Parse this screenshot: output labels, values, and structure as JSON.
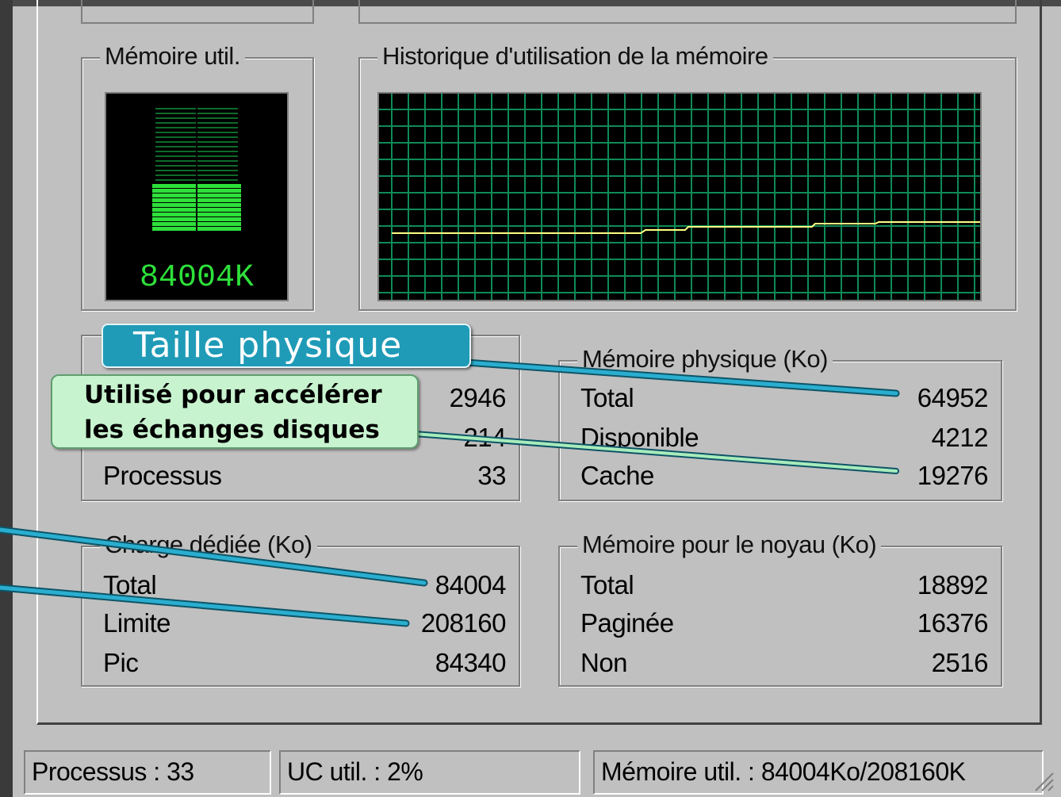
{
  "mem_usage": {
    "title": "Mémoire util.",
    "value_text": "84004K",
    "fill_fraction": 0.4
  },
  "mem_history": {
    "title": "Historique d'utilisation de la mémoire"
  },
  "totals": {
    "rows": [
      {
        "label": "",
        "value": "2946"
      },
      {
        "label": "",
        "value": "214"
      },
      {
        "label": "Processus",
        "value": "33"
      }
    ]
  },
  "physical": {
    "title": "Mémoire physique (Ko)",
    "rows": [
      {
        "label": "Total",
        "value": "64952"
      },
      {
        "label": "Disponible",
        "value": "4212"
      },
      {
        "label": "Cache",
        "value": "19276"
      }
    ]
  },
  "commit": {
    "title": "Charge dédiée (Ko)",
    "rows": [
      {
        "label": "Total",
        "value": "84004"
      },
      {
        "label": "Limite",
        "value": "208160"
      },
      {
        "label": "Pic",
        "value": "84340"
      }
    ]
  },
  "kernel": {
    "title": "Mémoire pour le noyau (Ko)",
    "rows": [
      {
        "label": "Total",
        "value": "18892"
      },
      {
        "label": "Paginée",
        "value": "16376"
      },
      {
        "label": "Non",
        "value": "2516"
      }
    ]
  },
  "callouts": {
    "physical_size": "Taille physique",
    "cache_line1": "Utilisé pour accélérer",
    "cache_line2": "les échanges disques"
  },
  "statusbar": {
    "processes": "Processus : 33",
    "cpu": "UC util. : 2%",
    "memory": "Mémoire util. : 84004Ko/208160K"
  },
  "colors": {
    "graph_grid": "#0f8a57",
    "graph_line": "#ffff80",
    "meter_green": "#2ee03a",
    "callout_blue": "#1f9bb7",
    "callout_green": "#c8f3cf"
  }
}
